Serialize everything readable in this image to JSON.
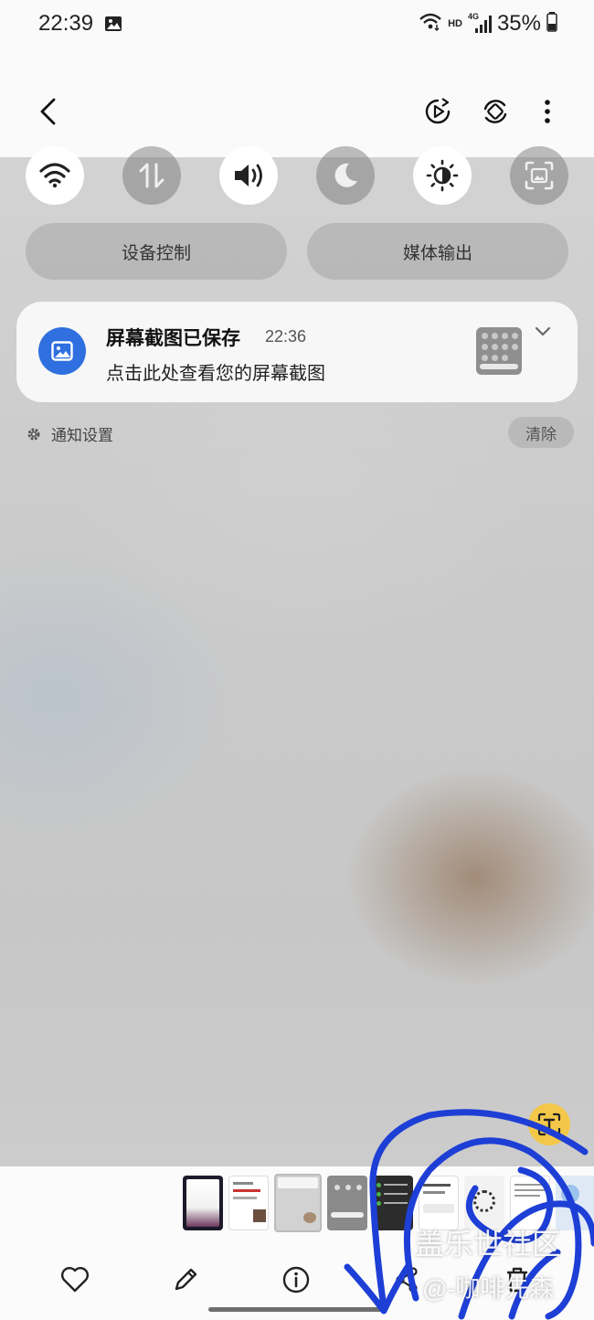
{
  "status_bar": {
    "time": "22:39",
    "network_hd": "HD",
    "network_gen": "4G",
    "battery": "35%"
  },
  "header": {
    "back_icon": "back-arrow-icon",
    "buttons": [
      "motion-photo-icon",
      "rotate-icon",
      "more-options-icon"
    ]
  },
  "quick_settings": {
    "toggles": [
      {
        "icon": "wifi-icon",
        "state": "on"
      },
      {
        "icon": "mobile-data-icon",
        "state": "off"
      },
      {
        "icon": "sound-icon",
        "state": "on"
      },
      {
        "icon": "dark-mode-icon",
        "state": "off"
      },
      {
        "icon": "brightness-icon",
        "state": "on"
      },
      {
        "icon": "screenshot-icon",
        "state": "off"
      }
    ],
    "device_control": "设备控制",
    "media_output": "媒体输出"
  },
  "notification": {
    "title": "屏幕截图已保存",
    "time": "22:36",
    "body": "点击此处查看您的屏幕截图"
  },
  "notification_settings": "通知设置",
  "clear": "清除",
  "bottom_actions": [
    "favorite-icon",
    "edit-icon",
    "info-icon",
    "share-icon",
    "delete-icon"
  ],
  "watermark": {
    "line1": "盖乐世社区",
    "line2": "@-咖啡先森"
  },
  "colors": {
    "notif_icon_bg": "#2f6fdf",
    "text_scan_bg": "#f3c84a",
    "annotation_ink": "#1e3fd6"
  }
}
